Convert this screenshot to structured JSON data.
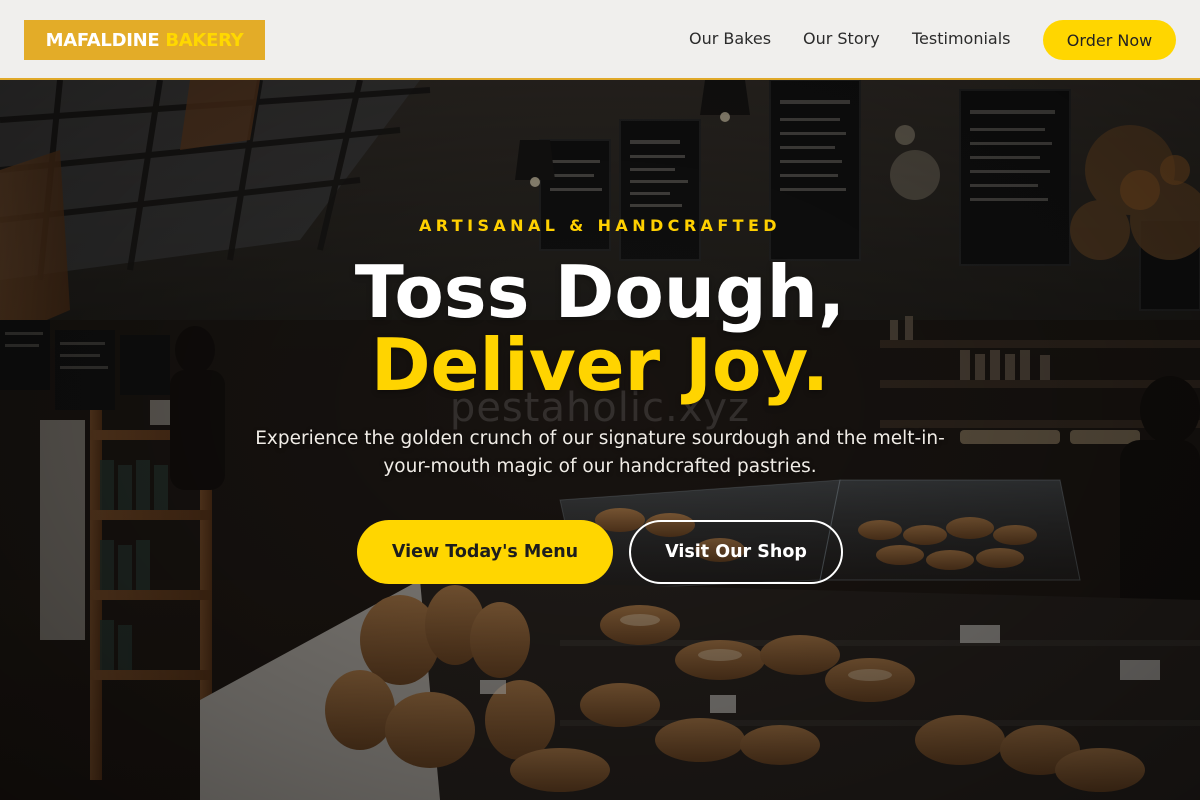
{
  "brand": {
    "name_part1": "MAFALDINE",
    "name_part2": "BAKERY"
  },
  "nav": {
    "links": [
      {
        "label": "Our Bakes"
      },
      {
        "label": "Our Story"
      },
      {
        "label": "Testimonials"
      }
    ],
    "cta_label": "Order Now"
  },
  "hero": {
    "eyebrow": "ARTISANAL & HANDCRAFTED",
    "headline_line1": "Toss Dough,",
    "headline_line2": "Deliver Joy.",
    "subtitle": "Experience the golden crunch of our signature sourdough and the melt-in-your-mouth magic of our handcrafted pastries.",
    "primary_button": "View Today's Menu",
    "secondary_button": "Visit Our Shop",
    "watermark": "pestaholic.xyz"
  },
  "colors": {
    "accent_yellow": "#ffd600",
    "logo_bg": "#e3ac28",
    "header_bg": "#f0efed",
    "header_border": "#e0a92a"
  },
  "icons": {
    "hero_background": "bakery-interior-image"
  }
}
